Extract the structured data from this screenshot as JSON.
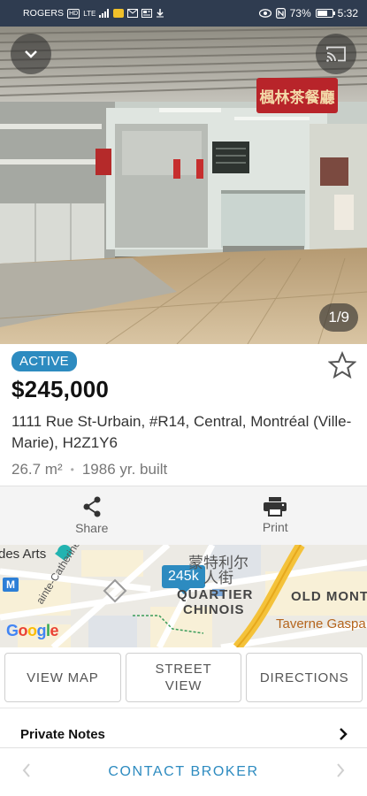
{
  "status_bar": {
    "carrier": "ROGERS",
    "hd_label": "HD",
    "network": "LTE",
    "battery_percent": "73%",
    "battery_level": 0.73,
    "time": "5:32"
  },
  "gallery": {
    "counter": "1/9",
    "sign_text": "楓林茶餐廳"
  },
  "listing": {
    "status_badge": "ACTIVE",
    "price": "$245,000",
    "address": "1111 Rue St-Urbain, #R14, Central, Montréal (Ville-Marie), H2Z1Y6",
    "area": "26.7 m²",
    "separator": "•",
    "year_built": "1986 yr. built",
    "favorited": false
  },
  "actions": {
    "share_label": "Share",
    "print_label": "Print"
  },
  "map": {
    "price_marker": "245k",
    "labels": {
      "des_arts": "des Arts",
      "street": "ainte-Catherine St W",
      "chinese": "蒙特利尔人街",
      "quartier": "QUARTIER",
      "chinois": "CHINOIS",
      "old_mont": "OLD MONT",
      "taverne": "Taverne Gaspa",
      "metro": "M"
    },
    "google_logo": "Google"
  },
  "map_buttons": {
    "view_map": "VIEW MAP",
    "street_view_line1": "STREET",
    "street_view_line2": "VIEW",
    "directions": "DIRECTIONS"
  },
  "notes": {
    "label": "Private Notes"
  },
  "bottom_bar": {
    "contact_label": "CONTACT BROKER"
  },
  "colors": {
    "accent": "#2d8bc0",
    "status_bar": "#2f3c50"
  }
}
